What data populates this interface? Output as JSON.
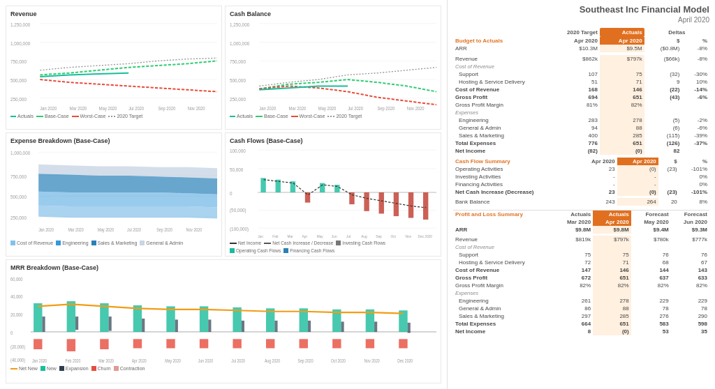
{
  "report": {
    "title": "Southeast Inc Financial Model",
    "subtitle": "April 2020"
  },
  "charts": {
    "revenue": {
      "title": "Revenue",
      "legend": [
        "Actuals",
        "Base-Case",
        "Worst-Case",
        "2020 Target"
      ],
      "y_labels": [
        "1,250,000",
        "1,000,000",
        "750,000",
        "500,000",
        "250,000"
      ],
      "x_labels": [
        "Jan 2020",
        "Mar 2020",
        "May 2020",
        "Jul 2020",
        "Sep 2020",
        "Nov 2020"
      ]
    },
    "cash_balance": {
      "title": "Cash Balance",
      "legend": [
        "Actuals",
        "Base-Case",
        "Worst-Case",
        "2020 Target"
      ],
      "y_labels": [
        "1,250,000",
        "1,000,000",
        "750,000",
        "500,000",
        "250,000"
      ],
      "x_labels": [
        "Jan 2020",
        "Mar 2020",
        "May 2020",
        "Jul 2020",
        "Sep 2020",
        "Nov 2020"
      ]
    },
    "expense_breakdown": {
      "title": "Expense Breakdown (Base-Case)",
      "legend": [
        "Cost of Revenue",
        "Engineering",
        "Sales & Marketing",
        "General & Admin"
      ],
      "y_labels": [
        "1,000,000",
        "750,000",
        "500,000",
        "250,000"
      ],
      "x_labels": [
        "Jan 2020",
        "Mar 2020",
        "May 2020",
        "Jul 2020",
        "Sep 2020",
        "Nov 2020"
      ]
    },
    "cash_flows": {
      "title": "Cash Flows (Base-Case)",
      "legend": [
        "Net Income",
        "Net Cash Increase / Decrease",
        "Investing Cash Flows",
        "Operating Cash Flows",
        "Financing Cash Flows"
      ],
      "y_labels": [
        "100,000",
        "50,000",
        "0",
        "(50,000)",
        "(100,000)"
      ],
      "x_labels": [
        "Jan",
        "Feb",
        "Mar",
        "Apr",
        "May",
        "Jun",
        "Jul",
        "Aug",
        "Sep",
        "Oct",
        "Nov",
        "Dec"
      ]
    },
    "mrr_breakdown": {
      "title": "MRR Breakdown (Base-Case)",
      "legend": [
        "Net New",
        "New",
        "Expansion",
        "Churn",
        "Contraction"
      ],
      "y_labels": [
        "60,000",
        "40,000",
        "20,000",
        "0",
        "(20,000)",
        "(40,000)"
      ],
      "x_labels": [
        "Jan 2020",
        "Feb 2020",
        "Mar 2020",
        "Apr 2020",
        "May 2020",
        "Jun 2020",
        "Jul 2020",
        "Aug 2020",
        "Sep 2020",
        "Oct 2020",
        "Nov 2020",
        "Dec 2020"
      ]
    }
  },
  "budget_to_actuals": {
    "section_label": "Budget to Actuals",
    "col_headers": [
      "2020 Target",
      "Actuals",
      "Deltas",
      ""
    ],
    "col_sub": [
      "Apr 2020",
      "Apr 2020",
      "$",
      "%"
    ],
    "rows": [
      {
        "label": "ARR",
        "target": "$10.3M",
        "actual": "$9.5M",
        "delta_d": "($0.8M)",
        "delta_p": "-8%",
        "bold": true
      },
      {
        "label": "",
        "target": "",
        "actual": "",
        "delta_d": "",
        "delta_p": ""
      },
      {
        "label": "Revenue",
        "target": "$862k",
        "actual": "$797k",
        "delta_d": "($66k)",
        "delta_p": "-8%"
      },
      {
        "label": "Cost of Revenue",
        "target": "",
        "actual": "",
        "delta_d": "",
        "delta_p": ""
      },
      {
        "label": "Support",
        "target": "107",
        "actual": "75",
        "delta_d": "(32)",
        "delta_p": "-30%"
      },
      {
        "label": "Hosting & Service Delivery",
        "target": "51",
        "actual": "71",
        "delta_d": "9",
        "delta_p": "10%"
      },
      {
        "label": "Cost of Revenue",
        "target": "168",
        "actual": "146",
        "delta_d": "(22)",
        "delta_p": "-14%",
        "bold": true
      },
      {
        "label": "Gross Profit",
        "target": "694",
        "actual": "651",
        "delta_d": "(43)",
        "delta_p": "-6%",
        "bold": true
      },
      {
        "label": "Gross Profit Margin",
        "target": "81%",
        "actual": "82%",
        "delta_d": "",
        "delta_p": ""
      },
      {
        "label": "Expenses",
        "target": "",
        "actual": "",
        "delta_d": "",
        "delta_p": ""
      },
      {
        "label": "Engineering",
        "target": "283",
        "actual": "278",
        "delta_d": "(5)",
        "delta_p": "-2%"
      },
      {
        "label": "General & Admin",
        "target": "94",
        "actual": "88",
        "delta_d": "(6)",
        "delta_p": "-6%"
      },
      {
        "label": "Sales & Marketing",
        "target": "400",
        "actual": "285",
        "delta_d": "(115)",
        "delta_p": "-39%"
      },
      {
        "label": "Total Expenses",
        "target": "776",
        "actual": "651",
        "delta_d": "(126)",
        "delta_p": "-37%",
        "bold": true
      },
      {
        "label": "Net Income",
        "target": "(82)",
        "actual": "(0)",
        "delta_d": "82",
        "delta_p": "",
        "bold": true
      }
    ]
  },
  "cash_flow_summary": {
    "section_label": "Cash Flow Summary",
    "col_sub": [
      "Apr 2020",
      "Apr 2020",
      "$",
      "%"
    ],
    "rows": [
      {
        "label": "Operating Activities",
        "target": "23",
        "actual": "(0)",
        "delta_d": "(23)",
        "delta_p": "-101%"
      },
      {
        "label": "Investing Activities",
        "target": "-",
        "actual": "-",
        "delta_d": "",
        "delta_p": "0%"
      },
      {
        "label": "Financing Activities",
        "target": "-",
        "actual": "-",
        "delta_d": "",
        "delta_p": "0%"
      },
      {
        "label": "Net Cash Increase (Decrease)",
        "target": "23",
        "actual": "(0)",
        "delta_d": "(23)",
        "delta_p": "-101%",
        "bold": true
      }
    ],
    "bank_balance": {
      "label": "Bank Balance",
      "target": "243",
      "actual": "264",
      "delta_d": "20",
      "delta_p": "8%"
    }
  },
  "pnl_summary": {
    "section_label": "Profit and Loss Summary",
    "col_headers": [
      "Actuals",
      "Actuals",
      "Forecast",
      "Forecast"
    ],
    "col_sub": [
      "Mar 2020",
      "Apr 2020",
      "May 2020",
      "Jun 2020"
    ],
    "rows": [
      {
        "label": "ARR",
        "c1": "$9.8M",
        "c2": "$9.8M",
        "c3": "$9.4M",
        "c4": "$9.3M",
        "bold": true
      },
      {
        "label": "",
        "c1": "",
        "c2": "",
        "c3": "",
        "c4": ""
      },
      {
        "label": "Revenue",
        "c1": "$819k",
        "c2": "$797k",
        "c3": "$780k",
        "c4": "$777k"
      },
      {
        "label": "Cost of Revenue",
        "c1": "",
        "c2": "",
        "c3": "",
        "c4": ""
      },
      {
        "label": "Support",
        "c1": "75",
        "c2": "75",
        "c3": "76",
        "c4": "76"
      },
      {
        "label": "Hosting & Service Delivery",
        "c1": "72",
        "c2": "71",
        "c3": "68",
        "c4": "67"
      },
      {
        "label": "Cost of Revenue",
        "c1": "147",
        "c2": "146",
        "c3": "144",
        "c4": "143",
        "bold": true
      },
      {
        "label": "Gross Profit",
        "c1": "672",
        "c2": "651",
        "c3": "637",
        "c4": "633",
        "bold": true
      },
      {
        "label": "Gross Profit Margin",
        "c1": "82%",
        "c2": "82%",
        "c3": "82%",
        "c4": "82%"
      },
      {
        "label": "Expenses",
        "c1": "",
        "c2": "",
        "c3": "",
        "c4": ""
      },
      {
        "label": "Engineering",
        "c1": "261",
        "c2": "278",
        "c3": "229",
        "c4": "229"
      },
      {
        "label": "General & Admin",
        "c1": "86",
        "c2": "88",
        "c3": "78",
        "c4": "78"
      },
      {
        "label": "Sales & Marketing",
        "c1": "297",
        "c2": "285",
        "c3": "276",
        "c4": "290"
      },
      {
        "label": "Total Expenses",
        "c1": "664",
        "c2": "651",
        "c3": "583",
        "c4": "598",
        "bold": true
      },
      {
        "label": "Net Income",
        "c1": "8",
        "c2": "(0)",
        "c3": "53",
        "c4": "35",
        "bold": true
      }
    ]
  }
}
